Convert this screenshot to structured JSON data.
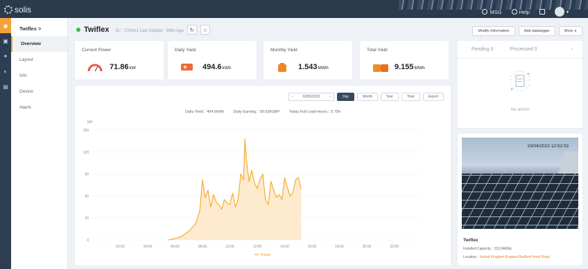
{
  "app": {
    "brand": "solis"
  },
  "topbar": {
    "msg": "MSG",
    "help": "Help"
  },
  "sidebar": {
    "title": "Twiflex >",
    "items": [
      {
        "label": "Overview"
      },
      {
        "label": "Layout"
      },
      {
        "label": "Info"
      },
      {
        "label": "Device"
      },
      {
        "label": "Alarm"
      }
    ]
  },
  "plant": {
    "name": "Twiflex",
    "meta": "ID：179AA1   Last Update：5Min Ago",
    "buttons": {
      "modify": "Modify Information",
      "add_logger": "Add datalogger",
      "more": "More ∨"
    }
  },
  "stats": [
    {
      "label": "Current Power",
      "value": "71.86",
      "unit": "kW"
    },
    {
      "label": "Daily Yield",
      "value": "494.6",
      "unit": "kWh"
    },
    {
      "label": "Monthly Yield",
      "value": "1.543",
      "unit": "MWh"
    },
    {
      "label": "Total Yield",
      "value": "9.155",
      "unit": "MWh"
    }
  ],
  "chart_controls": {
    "date": "02/05/2023",
    "prev": "‹",
    "next": "›",
    "day": "Day",
    "month": "Month",
    "year": "Year",
    "total": "Total",
    "export": "Export"
  },
  "chart_summary": {
    "daily_yield": "Daily Yield：494.6kWh",
    "daily_earning": "Daily Earning：69.536GBP",
    "full_load": "Today Full Load Hours：5.75h"
  },
  "chart_data": {
    "type": "area",
    "ylabel": "kW",
    "ylim": [
      0,
      150
    ],
    "yticks": [
      0,
      30,
      60,
      90,
      120,
      150
    ],
    "xticks": [
      "02:00",
      "04:00",
      "06:00",
      "08:00",
      "10:00",
      "12:00",
      "14:00",
      "16:00",
      "18:00",
      "20:00",
      "22:00"
    ],
    "xlim": [
      0,
      24
    ],
    "series": [
      {
        "name": "Power",
        "color": "#f5a623",
        "x": [
          5.5,
          6.0,
          6.5,
          7.0,
          7.5,
          7.8,
          8.0,
          8.2,
          8.4,
          8.6,
          8.8,
          9.0,
          9.2,
          9.4,
          9.6,
          9.8,
          10.0,
          10.2,
          10.4,
          10.6,
          10.8,
          11.0,
          11.1,
          11.2,
          11.4,
          11.6,
          11.8,
          12.0,
          12.2,
          12.4,
          12.6,
          12.8,
          13.0,
          13.2,
          13.4,
          13.6,
          13.8,
          14.0,
          14.2,
          14.4,
          14.6,
          14.8,
          15.0,
          15.2
        ],
        "y": [
          0,
          2,
          5,
          12,
          22,
          40,
          82,
          58,
          68,
          45,
          62,
          52,
          48,
          42,
          55,
          50,
          48,
          64,
          45,
          55,
          90,
          82,
          138,
          110,
          80,
          95,
          78,
          70,
          82,
          90,
          55,
          48,
          80,
          68,
          58,
          62,
          55,
          85,
          72,
          60,
          65,
          82,
          85,
          70
        ]
      }
    ],
    "legend": "bottom-center"
  },
  "alarm": {
    "pending": "Pending  0",
    "processed": "Processed  0",
    "chevron": "›",
    "empty": "No alarm"
  },
  "photo": {
    "timestamp": "23/04/2023 12:52:03",
    "title": "Twiflex",
    "capacity": "Installed Capacity：215.94kWp",
    "location_label": "Location：",
    "location_value": "United Kingdom England Bedford Hurst Road"
  },
  "colors": {
    "accent": "#f5a623",
    "nav": "#2b3b4e",
    "online": "#3cb94a"
  }
}
